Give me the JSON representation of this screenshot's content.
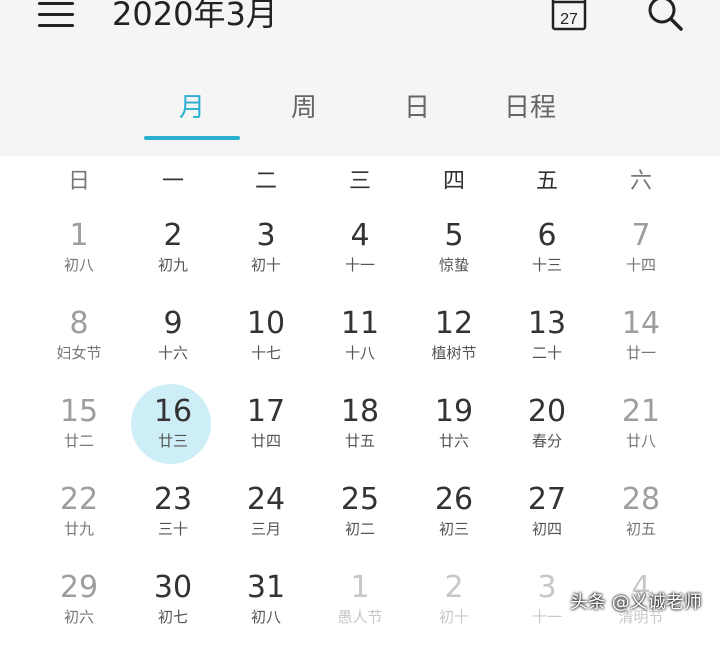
{
  "header": {
    "title": "2020年3月",
    "today_icon_day": "27",
    "tabs": [
      "月",
      "周",
      "日",
      "日程"
    ]
  },
  "weekdays": [
    "日",
    "一",
    "二",
    "三",
    "四",
    "五",
    "六"
  ],
  "rows": [
    [
      {
        "day": "1",
        "lunar": "初八"
      },
      {
        "day": "2",
        "lunar": "初九"
      },
      {
        "day": "3",
        "lunar": "初十"
      },
      {
        "day": "4",
        "lunar": "十一"
      },
      {
        "day": "5",
        "lunar": "惊蛰"
      },
      {
        "day": "6",
        "lunar": "十三"
      },
      {
        "day": "7",
        "lunar": "十四"
      }
    ],
    [
      {
        "day": "8",
        "lunar": "妇女节"
      },
      {
        "day": "9",
        "lunar": "十六"
      },
      {
        "day": "10",
        "lunar": "十七"
      },
      {
        "day": "11",
        "lunar": "十八"
      },
      {
        "day": "12",
        "lunar": "植树节"
      },
      {
        "day": "13",
        "lunar": "二十"
      },
      {
        "day": "14",
        "lunar": "廿一"
      }
    ],
    [
      {
        "day": "15",
        "lunar": "廿二"
      },
      {
        "day": "16",
        "lunar": "廿三"
      },
      {
        "day": "17",
        "lunar": "廿四"
      },
      {
        "day": "18",
        "lunar": "廿五"
      },
      {
        "day": "19",
        "lunar": "廿六"
      },
      {
        "day": "20",
        "lunar": "春分"
      },
      {
        "day": "21",
        "lunar": "廿八"
      }
    ],
    [
      {
        "day": "22",
        "lunar": "廿九"
      },
      {
        "day": "23",
        "lunar": "三十"
      },
      {
        "day": "24",
        "lunar": "三月"
      },
      {
        "day": "25",
        "lunar": "初二"
      },
      {
        "day": "26",
        "lunar": "初三"
      },
      {
        "day": "27",
        "lunar": "初四"
      },
      {
        "day": "28",
        "lunar": "初五"
      }
    ],
    [
      {
        "day": "29",
        "lunar": "初六"
      },
      {
        "day": "30",
        "lunar": "初七"
      },
      {
        "day": "31",
        "lunar": "初八"
      },
      {
        "day": "1",
        "lunar": "愚人节"
      },
      {
        "day": "2",
        "lunar": "初十"
      },
      {
        "day": "3",
        "lunar": "十一"
      },
      {
        "day": "4",
        "lunar": "清明节"
      }
    ]
  ],
  "selected_day": "16",
  "watermark": "头条 @义诚老师",
  "colors": {
    "accent": "#2bb0d2",
    "selected_bg": "#cdeef7",
    "header_bg": "#f5f5f5"
  }
}
